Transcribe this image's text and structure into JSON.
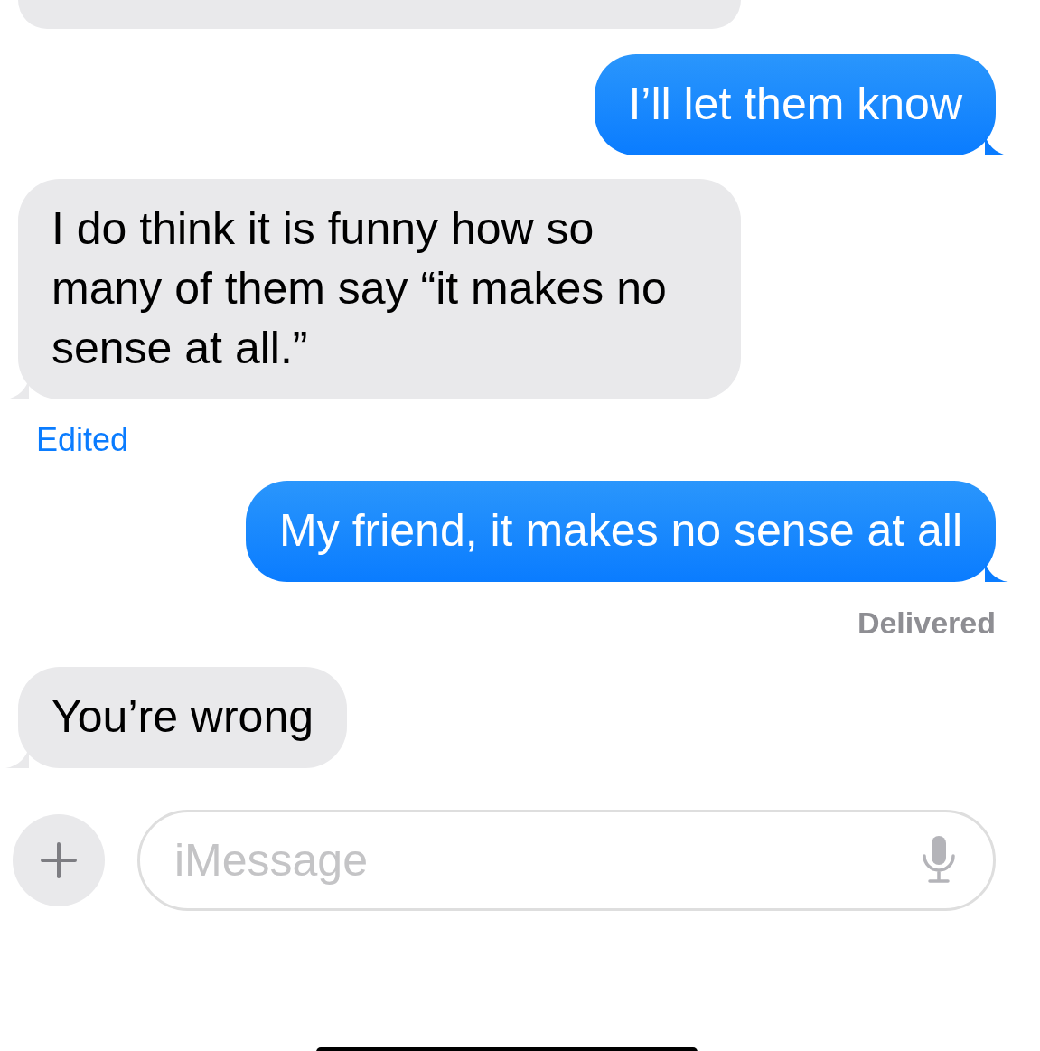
{
  "thread": [
    {
      "kind": "incoming",
      "partial": true
    },
    {
      "kind": "outgoing",
      "text": "I’ll let them know"
    },
    {
      "kind": "incoming",
      "text": "I do think it is funny how so many of them say “it makes no sense at all.”",
      "edited_label": "Edited"
    },
    {
      "kind": "outgoing",
      "text": "My friend, it makes no sense at all",
      "status": "Delivered"
    },
    {
      "kind": "incoming",
      "text": "You’re wrong"
    }
  ],
  "composer": {
    "placeholder": "iMessage"
  }
}
